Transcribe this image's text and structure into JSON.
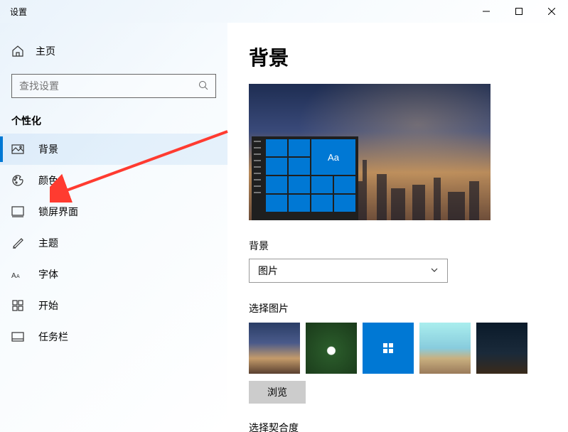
{
  "window": {
    "title": "设置"
  },
  "home": {
    "label": "主页"
  },
  "search": {
    "placeholder": "查找设置"
  },
  "section": {
    "title": "个性化"
  },
  "nav": {
    "items": [
      {
        "key": "background",
        "label": "背景"
      },
      {
        "key": "colors",
        "label": "颜色"
      },
      {
        "key": "lockscreen",
        "label": "锁屏界面"
      },
      {
        "key": "themes",
        "label": "主题"
      },
      {
        "key": "fonts",
        "label": "字体"
      },
      {
        "key": "start",
        "label": "开始"
      },
      {
        "key": "taskbar",
        "label": "任务栏"
      }
    ]
  },
  "page": {
    "title": "背景",
    "preview_sample_text": "Aa",
    "bg_label": "背景",
    "bg_selected": "图片",
    "choose_picture_label": "选择图片",
    "browse_label": "浏览",
    "fit_label": "选择契合度"
  }
}
